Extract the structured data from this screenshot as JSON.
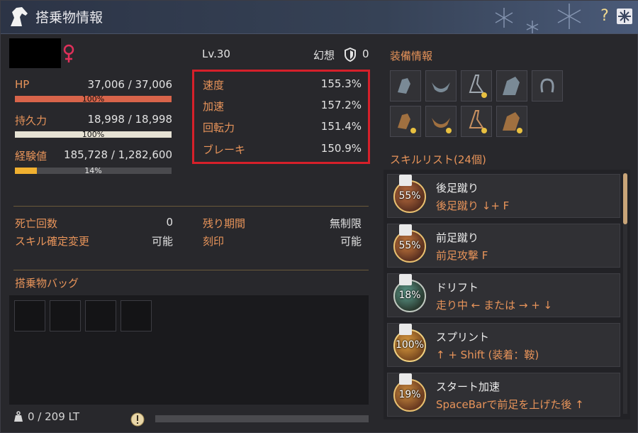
{
  "window": {
    "title": "搭乗物情報"
  },
  "profile": {
    "level": "Lv.30",
    "phantom_label": "幻想",
    "phantom_value": "0"
  },
  "stats": {
    "hp": {
      "label": "HP",
      "value": "37,006 / 37,006",
      "percent": "100%",
      "fill": 1.0
    },
    "stamina": {
      "label": "持久力",
      "value": "18,998 / 18,998",
      "percent": "100%",
      "fill": 1.0
    },
    "exp": {
      "label": "経験値",
      "value": "185,728 / 1,282,600",
      "percent": "14%",
      "fill": 0.14
    }
  },
  "speed_stats": [
    {
      "label": "速度",
      "value": "155.3%"
    },
    {
      "label": "加速",
      "value": "157.2%"
    },
    {
      "label": "回転力",
      "value": "151.4%"
    },
    {
      "label": "ブレーキ",
      "value": "150.9%"
    }
  ],
  "info": {
    "deaths_label": "死亡回数",
    "deaths_value": "0",
    "remaining_label": "残り期間",
    "remaining_value": "無制限",
    "skill_change_label": "スキル確定変更",
    "skill_change_value": "可能",
    "imprint_label": "刻印",
    "imprint_value": "可能"
  },
  "bag": {
    "title": "搭乗物バッグ",
    "weight": "0 / 209 LT"
  },
  "equipment": {
    "title": "装備情報"
  },
  "skills": {
    "title": "スキルリスト(24個)",
    "items": [
      {
        "name": "後足蹴り",
        "desc": "後足蹴り ↓+ F",
        "pct": "55%"
      },
      {
        "name": "前足蹴り",
        "desc": "前足攻撃 F",
        "pct": "55%"
      },
      {
        "name": "ドリフト",
        "desc": "走り中 ← または → + ↓",
        "pct": "18%"
      },
      {
        "name": "スプリント",
        "desc": "↑ + Shift (装着：鞍)",
        "pct": "100%"
      },
      {
        "name": "スタート加速",
        "desc": "SpaceBarで前足を上げた後 ↑",
        "pct": "19%"
      }
    ]
  },
  "colors": {
    "label_orange": "#e8945a",
    "hp_bar": "#d8644a",
    "stamina_bar": "#e6e2d4",
    "exp_bar": "#f0b030",
    "highlight_red": "#d6202a"
  },
  "icons": [
    "horse-head-icon",
    "snowflake-icon",
    "help-icon",
    "close-icon",
    "female-icon",
    "shield-icon",
    "weight-icon",
    "warning-icon"
  ]
}
